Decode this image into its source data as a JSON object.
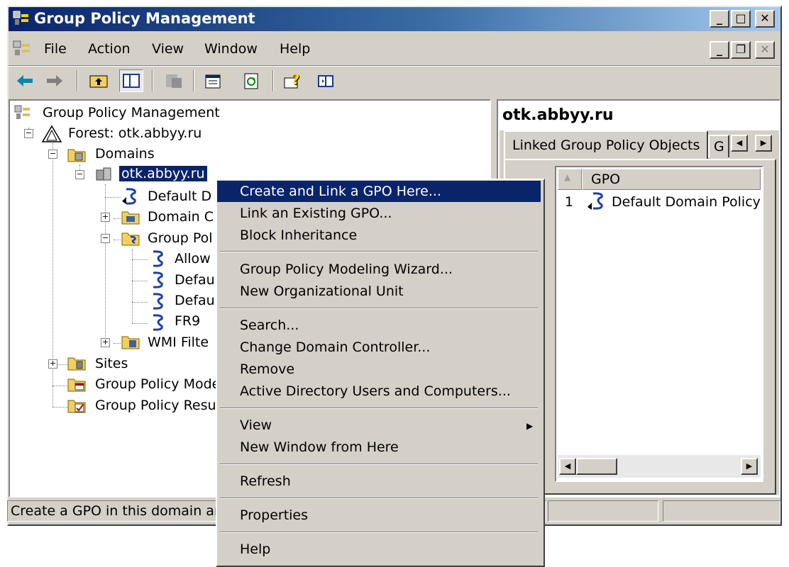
{
  "window": {
    "title": "Group Policy Management"
  },
  "menubar": {
    "items": [
      "File",
      "Action",
      "View",
      "Window",
      "Help"
    ]
  },
  "tree": {
    "root": "Group Policy Management",
    "forest": "Forest: otk.abbyy.ru",
    "domains": "Domains",
    "domain": "otk.abbyy.ru",
    "default_domain": "Default D",
    "domain_controllers": "Domain C",
    "group_policy_objects": "Group Pol",
    "gpo_allow": "Allow",
    "gpo_default1": "Defau",
    "gpo_default2": "Defau",
    "gpo_fr9": "FR9",
    "wmi_filters": "WMI Filte",
    "sites": "Sites",
    "modeling": "Group Policy Mode",
    "results": "Group Policy Resu"
  },
  "right_pane": {
    "heading": "otk.abbyy.ru",
    "tab_active": "Linked Group Policy Objects",
    "tab_next": "G",
    "column_gpo": "GPO",
    "rows": [
      {
        "order": "1",
        "name": "Default Domain Policy"
      }
    ]
  },
  "context_menu": {
    "group1": [
      "Create and Link a GPO Here...",
      "Link an Existing GPO...",
      "Block Inheritance"
    ],
    "group2": [
      "Group Policy Modeling Wizard...",
      "New Organizational Unit"
    ],
    "group3": [
      "Search...",
      "Change Domain Controller...",
      "Remove",
      "Active Directory Users and Computers..."
    ],
    "group4": [
      "View",
      "New Window from Here"
    ],
    "group5": [
      "Refresh"
    ],
    "group6": [
      "Properties"
    ],
    "group7": [
      "Help"
    ]
  },
  "statusbar": {
    "text": "Create a GPO in this domain an"
  },
  "colors": {
    "title_start": "#0a246a",
    "title_end": "#a6caf0",
    "highlight": "#0a246a",
    "face": "#d4d0c8"
  }
}
